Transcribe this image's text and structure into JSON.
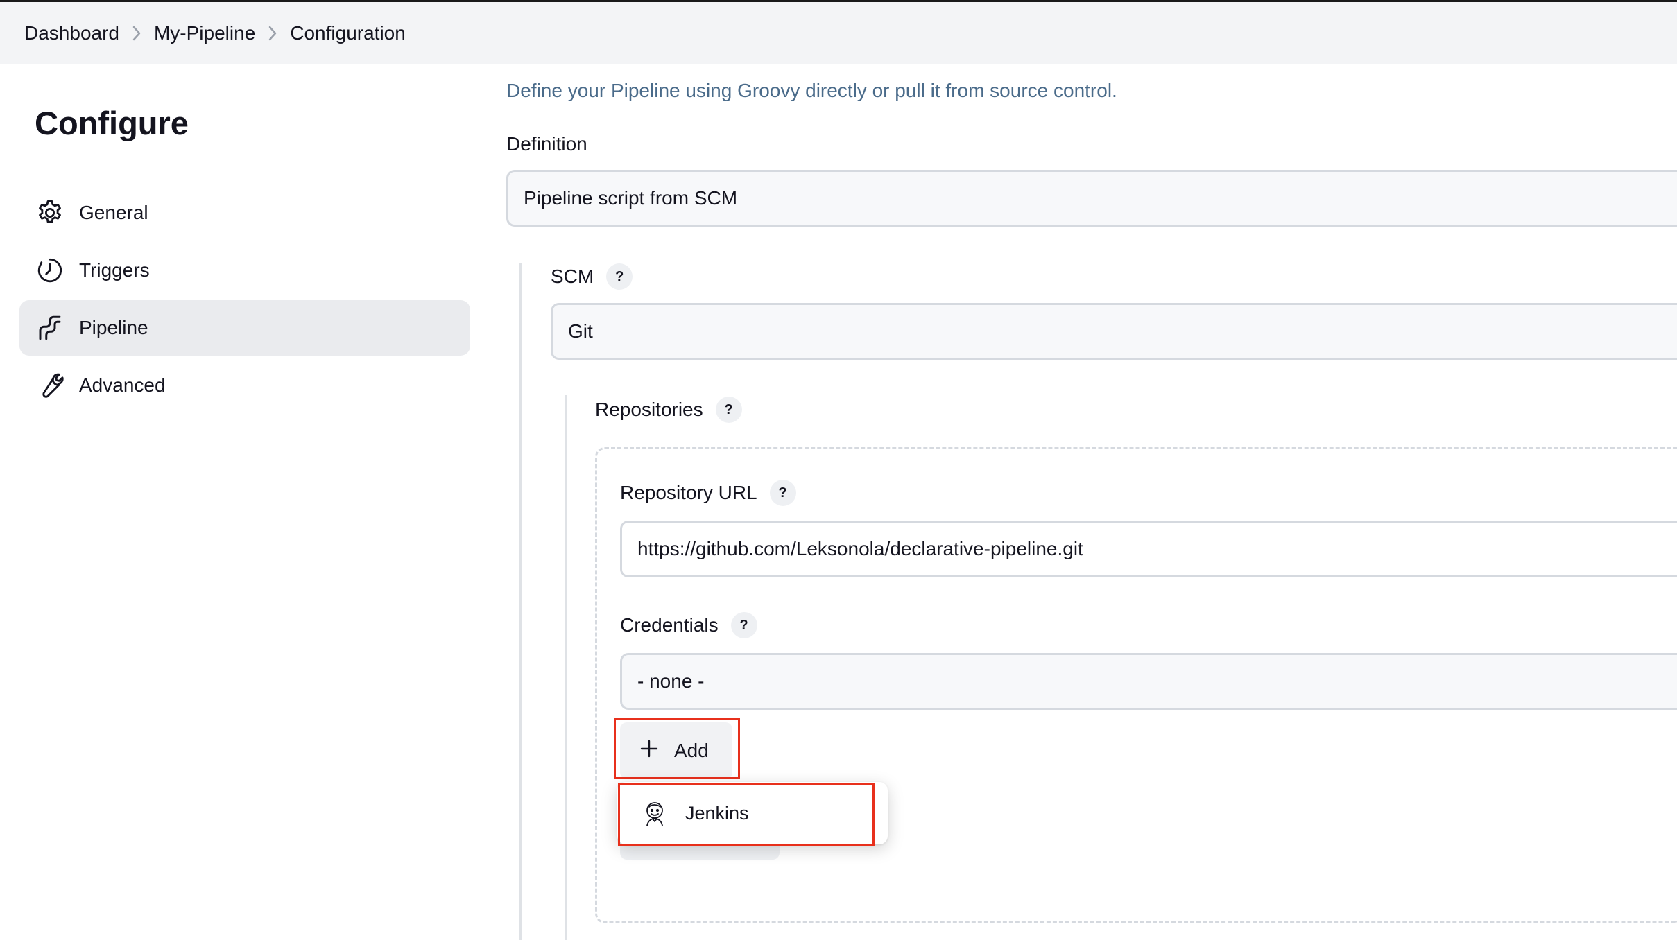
{
  "breadcrumb": {
    "items": [
      {
        "label": "Dashboard"
      },
      {
        "label": "My-Pipeline"
      },
      {
        "label": "Configuration"
      }
    ]
  },
  "sidebar": {
    "title": "Configure",
    "items": [
      {
        "label": "General",
        "icon": "gear-icon"
      },
      {
        "label": "Triggers",
        "icon": "clock-icon"
      },
      {
        "label": "Pipeline",
        "icon": "pipeline-icon",
        "active": true
      },
      {
        "label": "Advanced",
        "icon": "wrench-icon"
      }
    ]
  },
  "main": {
    "description": "Define your Pipeline using Groovy directly or pull it from source control.",
    "definition": {
      "label": "Definition",
      "value": "Pipeline script from SCM"
    },
    "scm": {
      "label": "SCM",
      "help": "?",
      "value": "Git"
    },
    "repositories": {
      "label": "Repositories",
      "help": "?"
    },
    "repository_url": {
      "label": "Repository URL",
      "help": "?",
      "value": "https://github.com/Leksonola/declarative-pipeline.git"
    },
    "credentials": {
      "label": "Credentials",
      "help": "?",
      "value": "- none -"
    },
    "add_button": {
      "label": "Add",
      "icon": "plus-icon"
    },
    "add_menu": {
      "items": [
        {
          "label": "Jenkins",
          "icon": "jenkins-icon"
        }
      ]
    }
  },
  "colors": {
    "highlight": "#e8301c",
    "description_text": "#4a6b8a",
    "breadcrumb_bg": "#f3f4f6"
  }
}
